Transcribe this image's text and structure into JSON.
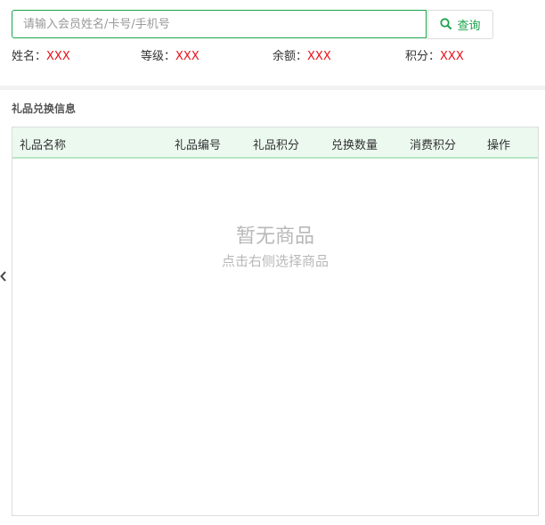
{
  "search": {
    "placeholder": "请输入会员姓名/卡号/手机号",
    "value": "",
    "button_label": "查询",
    "button_icon": "search-icon"
  },
  "member": {
    "name_label": "姓名：",
    "name_value": "XXX",
    "level_label": "等级：",
    "level_value": "XXX",
    "balance_label": "余额：",
    "balance_value": "XXX",
    "points_label": "积分：",
    "points_value": "XXX"
  },
  "section": {
    "title": "礼品兑换信息"
  },
  "table": {
    "columns": [
      "礼品名称",
      "礼品编号",
      "礼品积分",
      "兑换数量",
      "消费积分",
      "操作"
    ],
    "rows": []
  },
  "empty_state": {
    "title": "暂无商品",
    "subtitle": "点击右侧选择商品"
  },
  "sidebar_toggle_icon": "chevron-left-icon",
  "colors": {
    "accent": "#1aa34a",
    "value_red": "#e8101a",
    "header_bg": "#ebf9ef",
    "empty_text": "#b8b8b8"
  }
}
